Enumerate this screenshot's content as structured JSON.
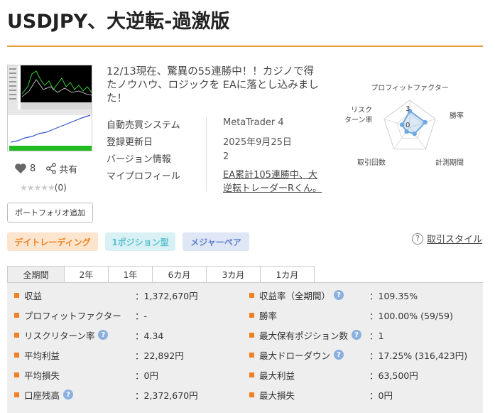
{
  "title": "USDJPY、大逆転-過激版",
  "description": "12/13現在、驚異の55連勝中！！カジノで得たノウハウ、ロジックを EAに落とし込みました！",
  "info": [
    {
      "key": "自動売買システム",
      "value": "MetaTrader 4"
    },
    {
      "key": "登録更新日",
      "value": "2025年9月25日"
    },
    {
      "key": "バージョン情報",
      "value": "2"
    },
    {
      "key": "マイプロフィール",
      "value": "EA累計105連勝中、大逆転トレーダーRくん。"
    }
  ],
  "likes": {
    "count": "8",
    "share_label": "共有"
  },
  "rating": {
    "stars": "★★★★★",
    "count": "(0)",
    "value": 0
  },
  "portfolio_button": "ポートフォリオ追加",
  "radar": {
    "labels": {
      "pf": "プロフィットファクター",
      "win": "勝率",
      "period": "計測期間",
      "trades": "取引回数",
      "risk1": "リスク",
      "risk2": "ターン率"
    },
    "ticks": [
      "3",
      "0"
    ],
    "values": {
      "pf": 3,
      "win": 3,
      "period": 1.5,
      "trades": 1,
      "risk": 1.5
    },
    "max": 5,
    "color": "#6fa8e0"
  },
  "tags": [
    "デイトレーディング",
    "1ポジション型",
    "メジャーペア"
  ],
  "trade_style_link": "取引スタイル",
  "tabs": [
    "全期間",
    "2年",
    "1年",
    "6カ月",
    "3カ月",
    "1カ月"
  ],
  "stats_left": [
    {
      "label": "収益",
      "value": "：1,372,670円",
      "help": false
    },
    {
      "label": "プロフィットファクター",
      "value": "：-",
      "help": false
    },
    {
      "label": "リスクリターン率",
      "value": "：4.34",
      "help": true
    },
    {
      "label": "平均利益",
      "value": "：22,892円",
      "help": false
    },
    {
      "label": "平均損失",
      "value": "：0円",
      "help": false
    },
    {
      "label": "口座残高",
      "value": "：2,372,670円",
      "help": true
    }
  ],
  "stats_right": [
    {
      "label": "収益率（全期間）",
      "value": "：109.35%",
      "help": true
    },
    {
      "label": "勝率",
      "value": "：100.00% (59/59)",
      "help": false
    },
    {
      "label": "最大保有ポジション数",
      "value": "：1",
      "help": true
    },
    {
      "label": "最大ドローダウン",
      "value": "：17.25% (316,423円)",
      "help": true
    },
    {
      "label": "最大利益",
      "value": "：63,500円",
      "help": false
    },
    {
      "label": "最大損失",
      "value": "：0円",
      "help": false
    }
  ],
  "colors": {
    "accent": "#f08020",
    "rule": "#e8a23a",
    "help": "#8ab0e0"
  }
}
